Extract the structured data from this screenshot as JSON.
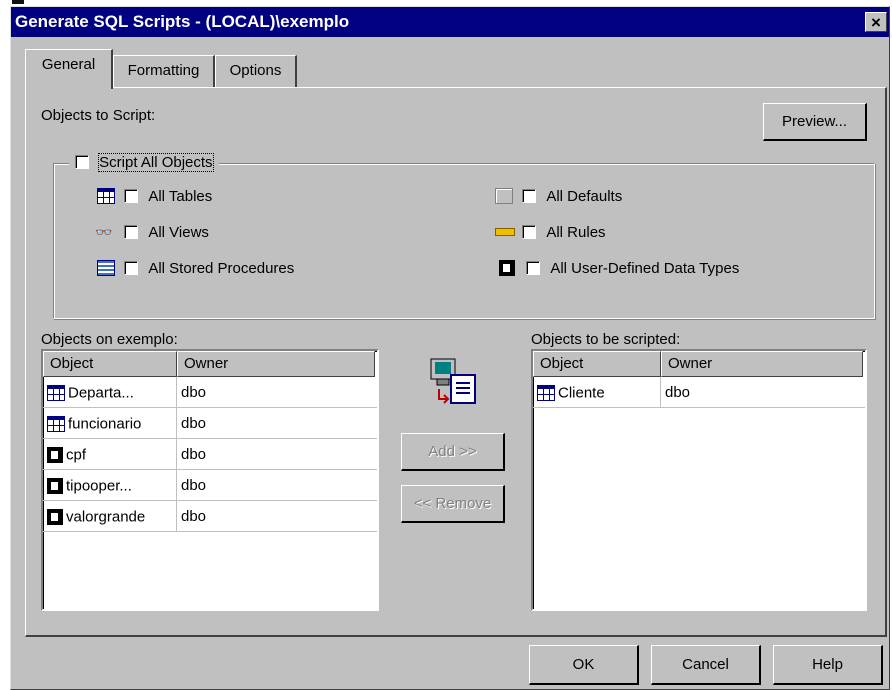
{
  "window": {
    "title": "Generate SQL Scripts - (LOCAL)\\exemplo",
    "close_glyph": "×"
  },
  "tabs": [
    {
      "label": "General",
      "active": true
    },
    {
      "label": "Formatting",
      "active": false
    },
    {
      "label": "Options",
      "active": false
    }
  ],
  "general": {
    "objects_to_script_label": "Objects to Script:",
    "preview_button": "Preview...",
    "script_all": {
      "label": "Script All Objects",
      "checked": false
    },
    "object_types": [
      {
        "label": "All Tables",
        "icon": "table-icon",
        "checked": false
      },
      {
        "label": "All Views",
        "icon": "view-icon",
        "checked": false
      },
      {
        "label": "All Stored Procedures",
        "icon": "stored-procedure-icon",
        "checked": false
      },
      {
        "label": "All Defaults",
        "icon": "default-icon",
        "checked": false
      },
      {
        "label": "All Rules",
        "icon": "rule-icon",
        "checked": false
      },
      {
        "label": "All User-Defined Data Types",
        "icon": "user-defined-type-icon",
        "checked": false
      }
    ],
    "source_list": {
      "label": "Objects on exemplo:",
      "columns": [
        "Object",
        "Owner"
      ],
      "rows": [
        {
          "icon": "table-icon",
          "object": "Departa...",
          "owner": "dbo"
        },
        {
          "icon": "table-icon",
          "object": "funcionario",
          "owner": "dbo"
        },
        {
          "icon": "user-defined-type-icon",
          "object": "cpf",
          "owner": "dbo"
        },
        {
          "icon": "user-defined-type-icon",
          "object": "tipooper...",
          "owner": "dbo"
        },
        {
          "icon": "user-defined-type-icon",
          "object": "valorgrande",
          "owner": "dbo"
        }
      ]
    },
    "add_button": "Add >>",
    "remove_button": "<< Remove",
    "target_list": {
      "label": "Objects to be scripted:",
      "columns": [
        "Object",
        "Owner"
      ],
      "rows": [
        {
          "icon": "table-icon",
          "object": "Cliente",
          "owner": "dbo"
        }
      ]
    }
  },
  "footer": {
    "ok": "OK",
    "cancel": "Cancel",
    "help": "Help"
  },
  "colors": {
    "titlebar": "#000080",
    "dialog_face": "#c0c0c0",
    "list_background": "#ffffff"
  }
}
